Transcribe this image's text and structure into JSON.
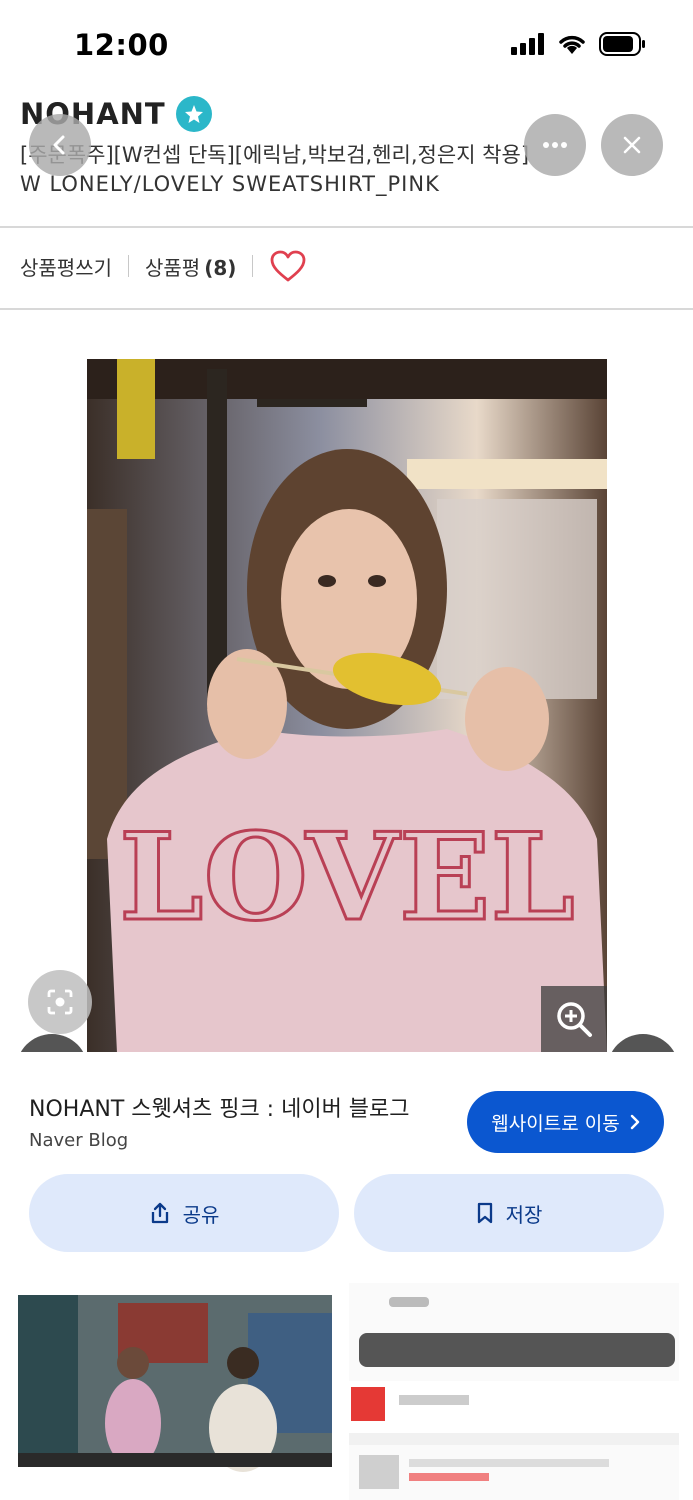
{
  "status_bar": {
    "time": "12:00"
  },
  "header": {
    "brand": "NOHANT",
    "title_line1": "[주문폭주][W컨셉 단독][에릭남,박보검,헨리,정은지 착용]",
    "title_line2": "W LONELY/LOVELY SWEATSHIRT_PINK"
  },
  "reviews": {
    "write_label": "상품평쓰기",
    "reviews_label": "상품평",
    "reviews_count": "(8)"
  },
  "result": {
    "title": "NOHANT 스웻셔츠 핑크 : 네이버 블로그",
    "source": "Naver Blog",
    "visit_label": "웹사이트로 이동",
    "share_label": "공유",
    "save_label": "저장"
  },
  "icons": [
    "back-icon",
    "more-icon",
    "close-icon",
    "heart-icon",
    "zoom-icon",
    "lens-icon",
    "share-icon",
    "bookmark-icon",
    "chevron-right-icon"
  ],
  "colors": {
    "accent": "#0b57d0",
    "pill": "#dfe9fb",
    "heart": "#e0404f",
    "verified": "#2bb7c9"
  }
}
